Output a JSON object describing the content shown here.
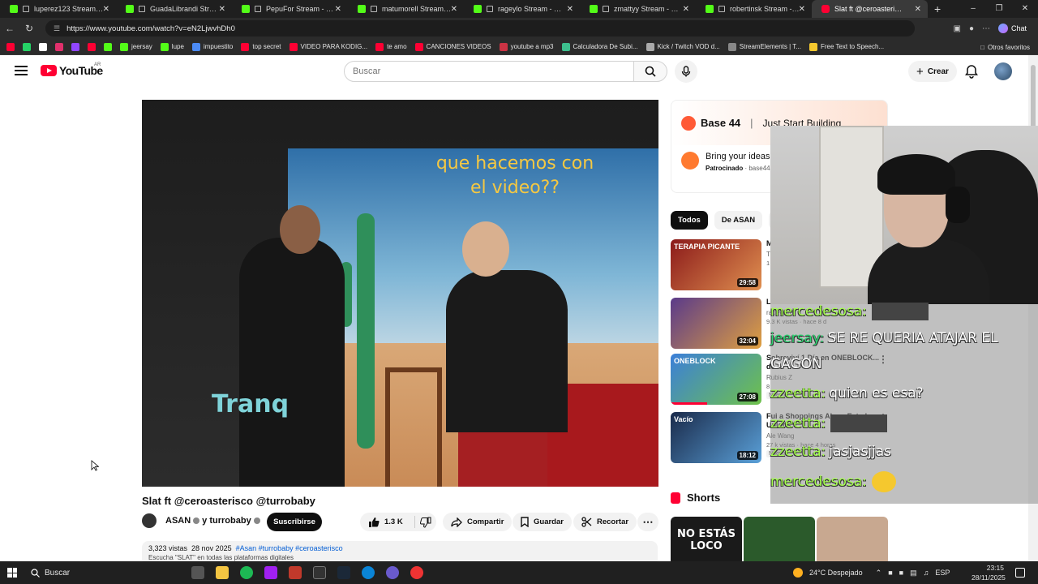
{
  "browser": {
    "tabs": [
      {
        "title": "luperez123 Stream - W",
        "icon": "kick-icon"
      },
      {
        "title": "GuadaLibrandi Stream",
        "icon": "kick-icon"
      },
      {
        "title": "PepuFor Stream - Watc",
        "icon": "kick-icon"
      },
      {
        "title": "matumorell Stream - W",
        "icon": "kick-icon"
      },
      {
        "title": "rageylo Stream - Watc",
        "icon": "kick-icon"
      },
      {
        "title": "zmattyy Stream - Watc",
        "icon": "kick-icon"
      },
      {
        "title": "robertinsk Stream - W",
        "icon": "kick-icon"
      },
      {
        "title": "Slat ft @ceroasterisco",
        "icon": "youtube-icon",
        "active": true
      }
    ],
    "url": "https://www.youtube.com/watch?v=eN2LjwvhDh0",
    "chat_label": "Chat",
    "bookmarks": [
      {
        "label": "",
        "color": "#ff0033"
      },
      {
        "label": "",
        "color": "#25d366"
      },
      {
        "label": "",
        "color": "#ffffff"
      },
      {
        "label": "",
        "color": "#e1306c"
      },
      {
        "label": "",
        "color": "#9146ff"
      },
      {
        "label": "",
        "color": "#ff0033"
      },
      {
        "label": "",
        "color": "#53fc18"
      },
      {
        "label": "jeersay",
        "color": "#53fc18"
      },
      {
        "label": "lupe",
        "color": "#53fc18"
      },
      {
        "label": "impuestito",
        "color": "#4c8bf5"
      },
      {
        "label": "top secret",
        "color": "#ff0033"
      },
      {
        "label": "VIDEO PARA KODIG...",
        "color": "#ff0033"
      },
      {
        "label": "te amo",
        "color": "#ff0033"
      },
      {
        "label": "CANCIONES VIDEOS",
        "color": "#ff0033"
      },
      {
        "label": "youtube a mp3",
        "color": "#cc3344"
      },
      {
        "label": "Calculadora De Subi...",
        "color": "#3dbf8e"
      },
      {
        "label": "Kick / Twitch VOD d...",
        "color": "#aaaaaa"
      },
      {
        "label": "StreamElements | T...",
        "color": "#888888"
      },
      {
        "label": "Free Text to Speech...",
        "color": "#f5c82e"
      }
    ],
    "bookmarks_other": "Otros favoritos"
  },
  "youtube": {
    "logo_text": "YouTube",
    "country_code": "AR",
    "search_placeholder": "Buscar",
    "create_label": "Crear",
    "video": {
      "caption_top": "que hacemos con el video??",
      "caption_bottom": "Tranq",
      "title": "Slat ft @ceroasterisco @turrobaby",
      "channel": "ASAN",
      "channel_extra": "y turrobaby",
      "subscribe_label": "Suscribirse",
      "likes": "1.3 K",
      "share_label": "Compartir",
      "save_label": "Guardar",
      "clip_label": "Recortar",
      "views": "3,323 vistas",
      "date": "28 nov 2025",
      "tags": "#Asan #turrobaby #ceroasterisco",
      "description_line": "Escucha \"SLAT\" en todas las plataformas digitales"
    },
    "ad": {
      "brand": "Base 44",
      "slogan": "Just Start Building",
      "text": "Bring your ideas to life",
      "sponsored": "Patrocinado",
      "domain": "base44"
    },
    "chips": [
      "Todos",
      "De ASAN",
      "H"
    ],
    "recommendations": [
      {
        "title": "M D",
        "channel": "T",
        "meta": "1",
        "duration": "29:58",
        "thumb_text": "TERAPIA PICANTE",
        "color1": "#8b1a1a",
        "color2": "#e09050"
      },
      {
        "title": "L F",
        "channel": "rageylord",
        "meta": "9.3 K vistas · hace 8 d",
        "duration": "32:04",
        "thumb_text": "",
        "color1": "#5a3a8a",
        "color2": "#e0a040"
      },
      {
        "title": "Sobreviví 1 Día en ONEBLOCK... de",
        "channel": "Rubius Z",
        "meta": "8",
        "duration": "27:08",
        "thumb_text": "ONEBLOCK",
        "color1": "#3b7fd9",
        "color2": "#6fc24a",
        "nuevo": "Nuevo"
      },
      {
        "title": "Fui a Shoppings Ab en Estados Unidos",
        "channel": "Ale Wang",
        "meta": "27 k vistas · hace 4 horas",
        "duration": "18:12",
        "thumb_text": "Vacío",
        "color1": "#1a2a4a",
        "color2": "#5aa0d8",
        "nuevo": "Nuevo"
      }
    ],
    "shorts_label": "Shorts",
    "shorts": [
      {
        "text": "NO ESTÁS LOCO",
        "color": "#1a1a1a"
      },
      {
        "text": "",
        "color": "#2b5a2b"
      },
      {
        "text": "",
        "color": "#c8a890"
      }
    ]
  },
  "stream_chat": [
    {
      "user": "mercedesosa:",
      "text": "",
      "emote": "emote-box"
    },
    {
      "user": "jeersay:",
      "text": "SE RE QUERIA ATAJAR EL",
      "emote": ""
    },
    {
      "user": "",
      "text": "GAGON",
      "emote": ""
    },
    {
      "user": "zzeetta:",
      "text": "quien es esa?",
      "emote": ""
    },
    {
      "user": "zzeetta:",
      "text": "",
      "emote": "emote-box"
    },
    {
      "user": "zzeetta:",
      "text": "jasjasjjas",
      "emote": ""
    },
    {
      "user": "mercedesosa:",
      "text": "",
      "emote": "emote-face"
    }
  ],
  "taskbar": {
    "search_label": "Buscar",
    "weather": "24°C  Despejado",
    "lang": "ESP",
    "time": "23:15",
    "date": "28/11/2025"
  }
}
